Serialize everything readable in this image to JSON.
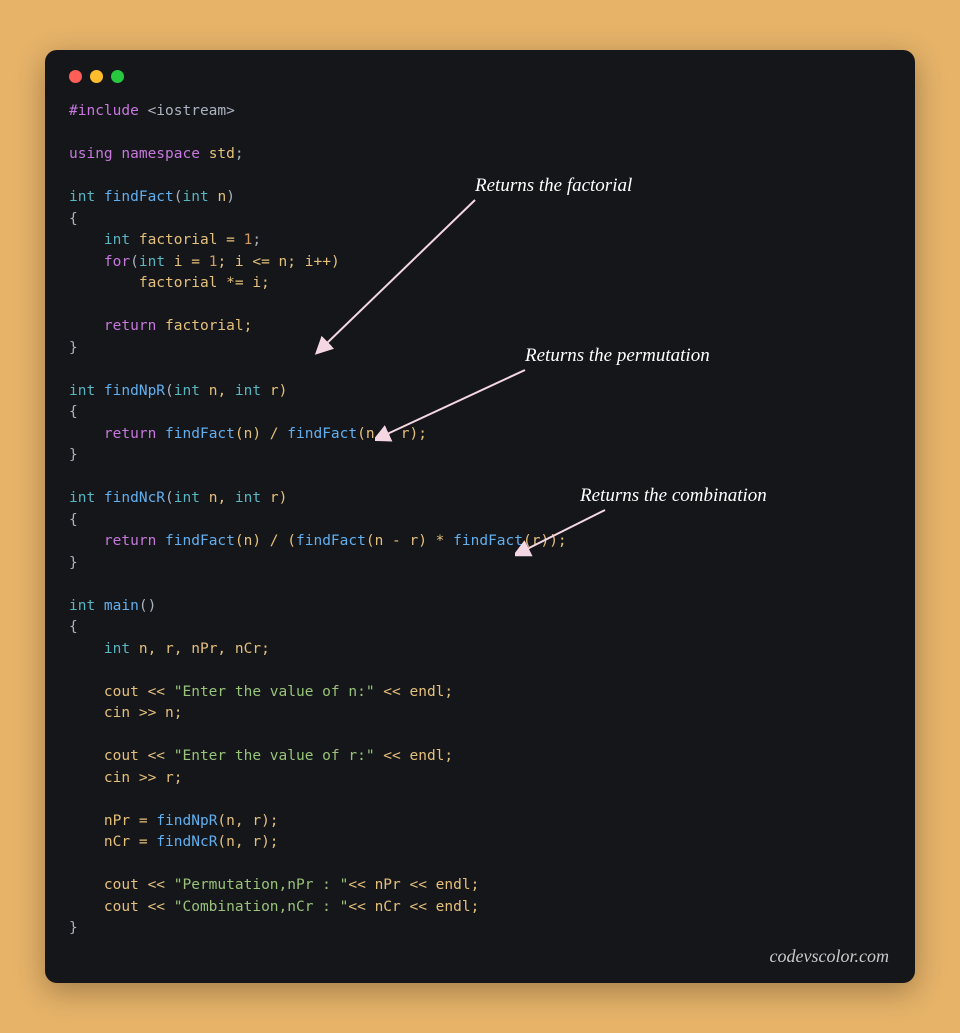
{
  "annotations": {
    "a1": "Returns the factorial",
    "a2": "Returns the permutation",
    "a3": "Returns the combination"
  },
  "watermark": "codevscolor.com",
  "code": {
    "l0a": "#include",
    "l0b": " <iostream>",
    "l2a": "using",
    "l2b": " namespace",
    "l2c": " std",
    "l2d": ";",
    "l4a": "int",
    "l4b": " findFact",
    "l4c": "(",
    "l4d": "int",
    "l4e": " n",
    "l4f": ")",
    "l5": "{",
    "l6a": "    ",
    "l6b": "int",
    "l6c": " factorial = ",
    "l6d": "1",
    "l6e": ";",
    "l7a": "    ",
    "l7b": "for",
    "l7c": "(",
    "l7d": "int",
    "l7e": " i = ",
    "l7f": "1",
    "l7g": "; i <= n; i++)",
    "l8a": "        factorial *= i;",
    "l10a": "    ",
    "l10b": "return",
    "l10c": " factorial;",
    "l11": "}",
    "l13a": "int",
    "l13b": " findNpR",
    "l13c": "(",
    "l13d": "int",
    "l13e": " n, ",
    "l13f": "int",
    "l13g": " r)",
    "l14": "{",
    "l15a": "    ",
    "l15b": "return",
    "l15c": " findFact",
    "l15d": "(n) / ",
    "l15e": "findFact",
    "l15f": "(n - r);",
    "l16": "}",
    "l18a": "int",
    "l18b": " findNcR",
    "l18c": "(",
    "l18d": "int",
    "l18e": " n, ",
    "l18f": "int",
    "l18g": " r)",
    "l19": "{",
    "l20a": "    ",
    "l20b": "return",
    "l20c": " findFact",
    "l20d": "(n) / (",
    "l20e": "findFact",
    "l20f": "(n - r) * ",
    "l20g": "findFact",
    "l20h": "(r));",
    "l21": "}",
    "l23a": "int",
    "l23b": " main",
    "l23c": "()",
    "l24": "{",
    "l25a": "    ",
    "l25b": "int",
    "l25c": " n, r, nPr, nCr;",
    "l27a": "    cout << ",
    "l27b": "\"Enter the value of n:\"",
    "l27c": " << endl;",
    "l28": "    cin >> n;",
    "l30a": "    cout << ",
    "l30b": "\"Enter the value of r:\"",
    "l30c": " << endl;",
    "l31": "    cin >> r;",
    "l33a": "    nPr = ",
    "l33b": "findNpR",
    "l33c": "(n, r);",
    "l34a": "    nCr = ",
    "l34b": "findNcR",
    "l34c": "(n, r);",
    "l36a": "    cout << ",
    "l36b": "\"Permutation,nPr : \"",
    "l36c": "<< nPr << endl;",
    "l37a": "    cout << ",
    "l37b": "\"Combination,nCr : \"",
    "l37c": "<< nCr << endl;",
    "l38": "}"
  }
}
